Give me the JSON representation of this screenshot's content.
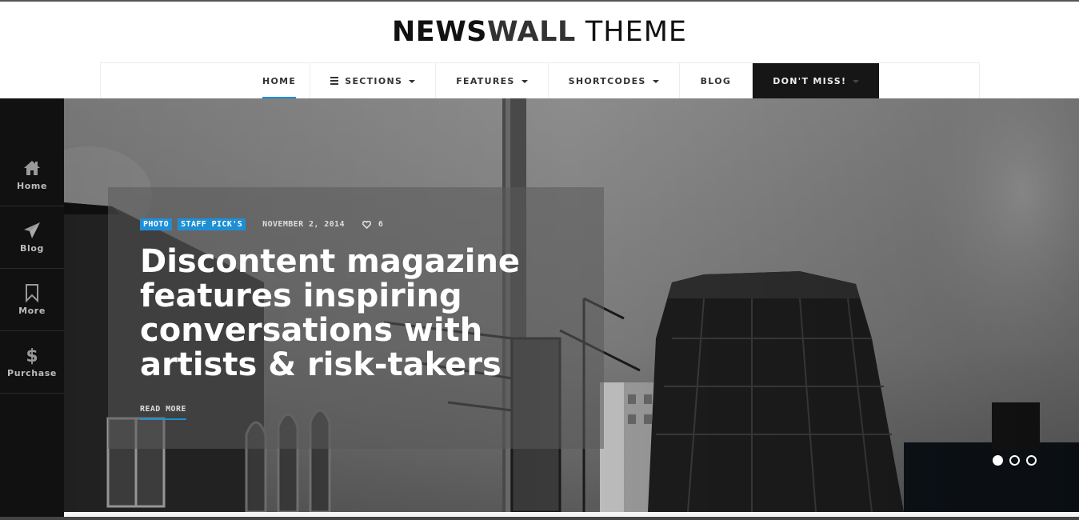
{
  "logo": {
    "part1": "NEWS",
    "part2": "WALL",
    "part3": " THEME"
  },
  "nav": {
    "items": [
      {
        "label": "HOME",
        "active": true
      },
      {
        "label": "SECTIONS",
        "icon": "menu-icon",
        "dropdown": true
      },
      {
        "label": "FEATURES",
        "dropdown": true
      },
      {
        "label": "SHORTCODES",
        "dropdown": true
      },
      {
        "label": "BLOG"
      },
      {
        "label": "DON'T MISS!",
        "dropdown": true,
        "highlighted": true
      }
    ]
  },
  "sidebar": {
    "items": [
      {
        "label": "Home",
        "icon": "home-icon"
      },
      {
        "label": "Blog",
        "icon": "paper-plane-icon"
      },
      {
        "label": "More",
        "icon": "bookmark-icon"
      },
      {
        "label": "Purchase",
        "icon": "dollar-icon"
      }
    ]
  },
  "hero": {
    "tags": [
      "PHOTO",
      "STAFF PICK'S"
    ],
    "date": "NOVEMBER 2, 2014",
    "likes": "6",
    "headline": "Discontent magazine features inspiring conversations with artists & risk-takers",
    "read_more": "READ MORE",
    "slides": {
      "count": 3,
      "active": 1
    }
  },
  "colors": {
    "accent": "#1e8fd6",
    "dark": "#161616",
    "sidebar": "#111111"
  }
}
